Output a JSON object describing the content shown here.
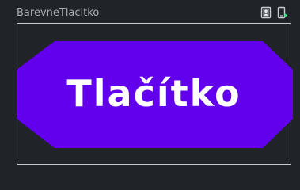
{
  "panel": {
    "title": "BarevneTlacitko"
  },
  "toolbar": {
    "icons": [
      "design-mode-icon",
      "device-preview-icon"
    ]
  },
  "preview": {
    "button_label": "Tlačítko",
    "button_color": "#6200ee",
    "label_color": "#ffffff"
  },
  "colors": {
    "background": "#202328",
    "frame_border": "#c6c9ce",
    "title_text": "#a8adb5",
    "icon_accent": "#3ddc84"
  }
}
